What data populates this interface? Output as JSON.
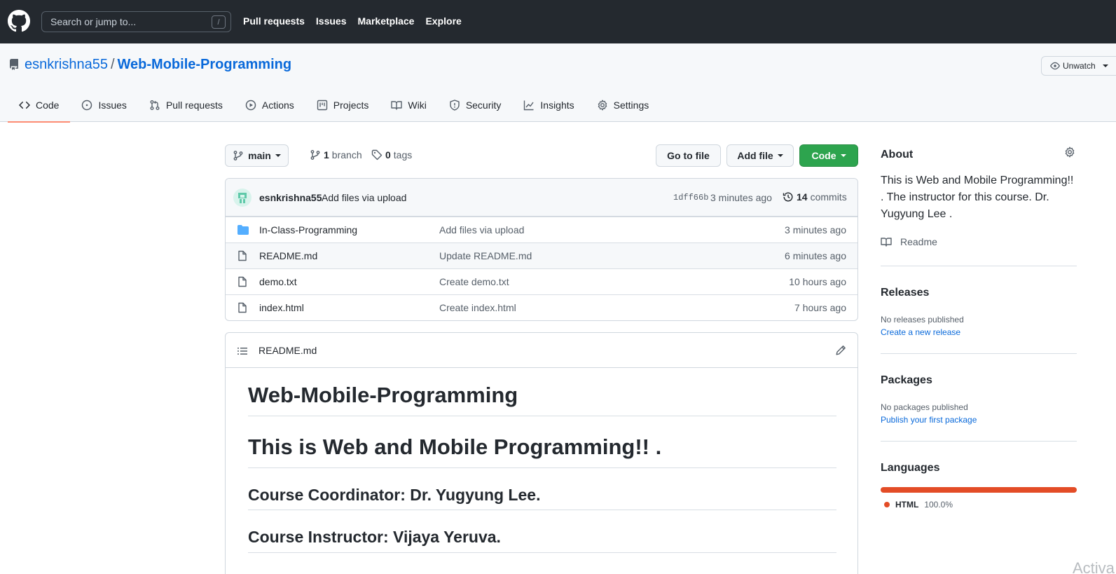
{
  "header": {
    "search_placeholder": "Search or jump to...",
    "search_shortcut": "/",
    "nav": [
      "Pull requests",
      "Issues",
      "Marketplace",
      "Explore"
    ]
  },
  "repo": {
    "owner": "esnkrishna55",
    "separator": "/",
    "name": "Web-Mobile-Programming",
    "watch_label": "Unwatch"
  },
  "tabs": [
    {
      "label": "Code",
      "icon": "code-icon",
      "active": true
    },
    {
      "label": "Issues",
      "icon": "issue-icon"
    },
    {
      "label": "Pull requests",
      "icon": "pull-request-icon"
    },
    {
      "label": "Actions",
      "icon": "play-icon"
    },
    {
      "label": "Projects",
      "icon": "project-icon"
    },
    {
      "label": "Wiki",
      "icon": "book-icon"
    },
    {
      "label": "Security",
      "icon": "shield-icon"
    },
    {
      "label": "Insights",
      "icon": "graph-icon"
    },
    {
      "label": "Settings",
      "icon": "gear-icon"
    }
  ],
  "toolbar": {
    "branch": "main",
    "branch_count": "1",
    "branch_label": "branch",
    "tag_count": "0",
    "tag_label": "tags",
    "go_to_file": "Go to file",
    "add_file": "Add file",
    "code": "Code"
  },
  "commit": {
    "author": "esnkrishna55",
    "message": "Add files via upload",
    "sha": "1dff66b",
    "time": "3 minutes ago",
    "count": "14",
    "count_label": "commits"
  },
  "files": [
    {
      "type": "folder",
      "name": "In-Class-Programming",
      "message": "Add files via upload",
      "time": "3 minutes ago"
    },
    {
      "type": "file",
      "name": "README.md",
      "message": "Update README.md",
      "time": "6 minutes ago"
    },
    {
      "type": "file",
      "name": "demo.txt",
      "message": "Create demo.txt",
      "time": "10 hours ago"
    },
    {
      "type": "file",
      "name": "index.html",
      "message": "Create index.html",
      "time": "7 hours ago"
    }
  ],
  "readme": {
    "filename": "README.md",
    "h1": "Web-Mobile-Programming",
    "h1b": "This is Web and Mobile Programming!! .",
    "h2a": "Course Coordinator: Dr. Yugyung Lee.",
    "h2b": "Course Instructor: Vijaya Yeruva."
  },
  "sidebar": {
    "about_title": "About",
    "about_text": "This is Web and Mobile Programming!! . The instructor for this course. Dr. Yugyung Lee .",
    "readme_link": "Readme",
    "releases_title": "Releases",
    "releases_none": "No releases published",
    "releases_link": "Create a new release",
    "packages_title": "Packages",
    "packages_none": "No packages published",
    "packages_link": "Publish your first package",
    "languages_title": "Languages",
    "language_name": "HTML",
    "language_pct": "100.0%",
    "language_color": "#e34c26"
  },
  "watermark": "Activa"
}
